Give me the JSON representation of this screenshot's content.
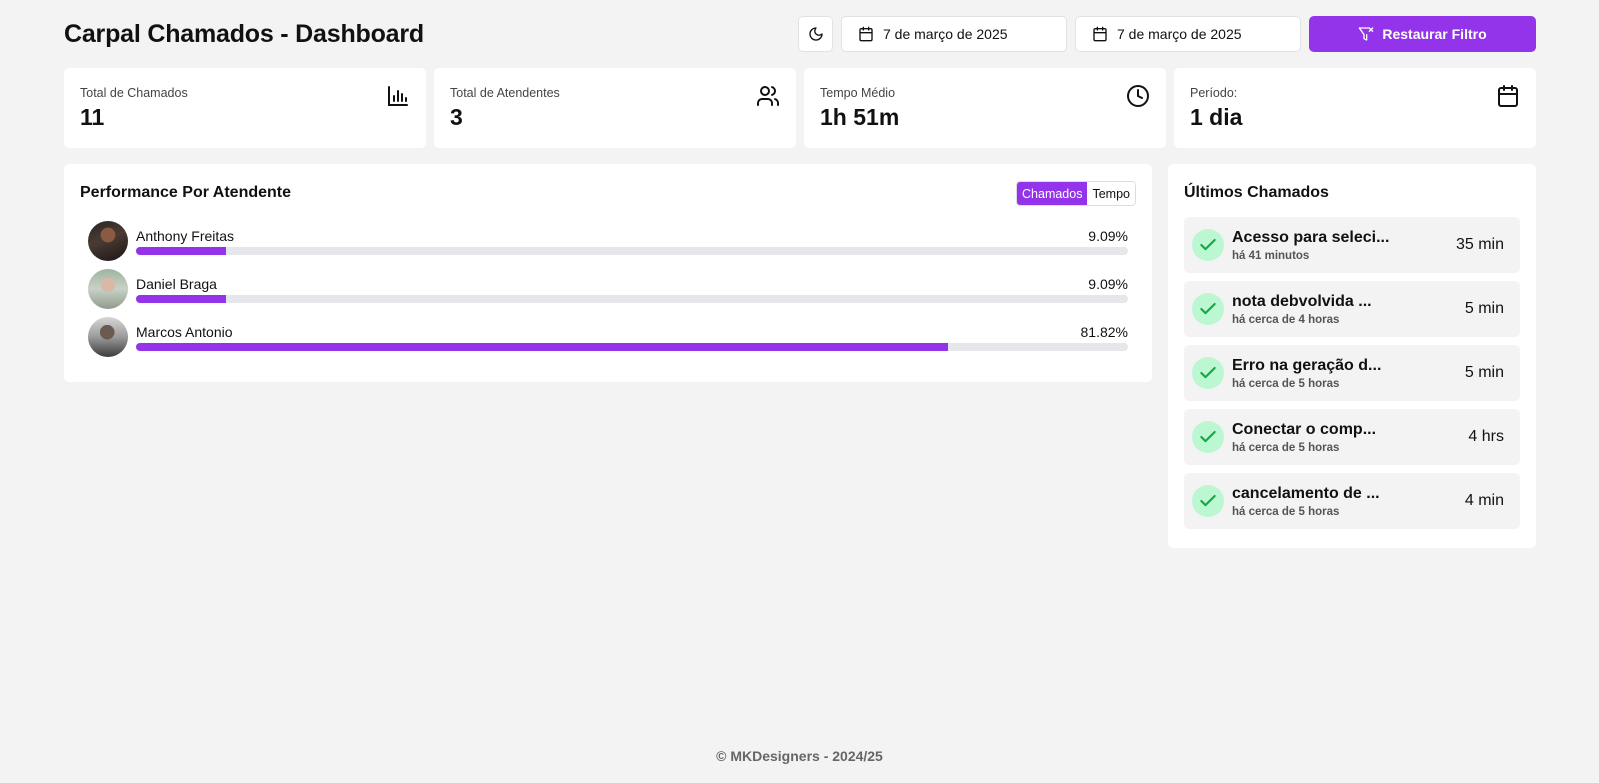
{
  "header": {
    "title": "Carpal Chamados - Dashboard",
    "date_start": "7 de março de 2025",
    "date_end": "7 de março de 2025",
    "reset_label": "Restaurar Filtro"
  },
  "stats": [
    {
      "label": "Total de Chamados",
      "value": "11",
      "icon": "bar-chart-icon"
    },
    {
      "label": "Total de Atendentes",
      "value": "3",
      "icon": "users-icon"
    },
    {
      "label": "Tempo Médio",
      "value": "1h 51m",
      "icon": "clock-icon"
    },
    {
      "label": "Período:",
      "value": "1 dia",
      "icon": "calendar-icon"
    }
  ],
  "performance": {
    "title": "Performance Por Atendente",
    "toggle": {
      "active": "Chamados",
      "inactive": "Tempo"
    },
    "agents": [
      {
        "name": "Anthony Freitas",
        "percent_label": "9.09%",
        "percent": 9.09
      },
      {
        "name": "Daniel Braga",
        "percent_label": "9.09%",
        "percent": 9.09
      },
      {
        "name": "Marcos Antonio",
        "percent_label": "81.82%",
        "percent": 81.82
      }
    ]
  },
  "recent": {
    "title": "Últimos Chamados",
    "tickets": [
      {
        "title": "Acesso para seleci...",
        "time": "há 41 minutos",
        "duration": "35 min"
      },
      {
        "title": "nota debvolvida ...",
        "time": "há cerca de 4 horas",
        "duration": "5 min"
      },
      {
        "title": "Erro na geração d...",
        "time": "há cerca de 5 horas",
        "duration": "5 min"
      },
      {
        "title": "Conectar o comp...",
        "time": "há cerca de 5 horas",
        "duration": "4 hrs"
      },
      {
        "title": "cancelamento de ...",
        "time": "há cerca de 5 horas",
        "duration": "4 min"
      }
    ]
  },
  "footer": {
    "text": "© MKDesigners - 2024/25"
  },
  "colors": {
    "accent": "#9333ea",
    "success_bg": "#bbf7d0",
    "success": "#16a34a"
  }
}
